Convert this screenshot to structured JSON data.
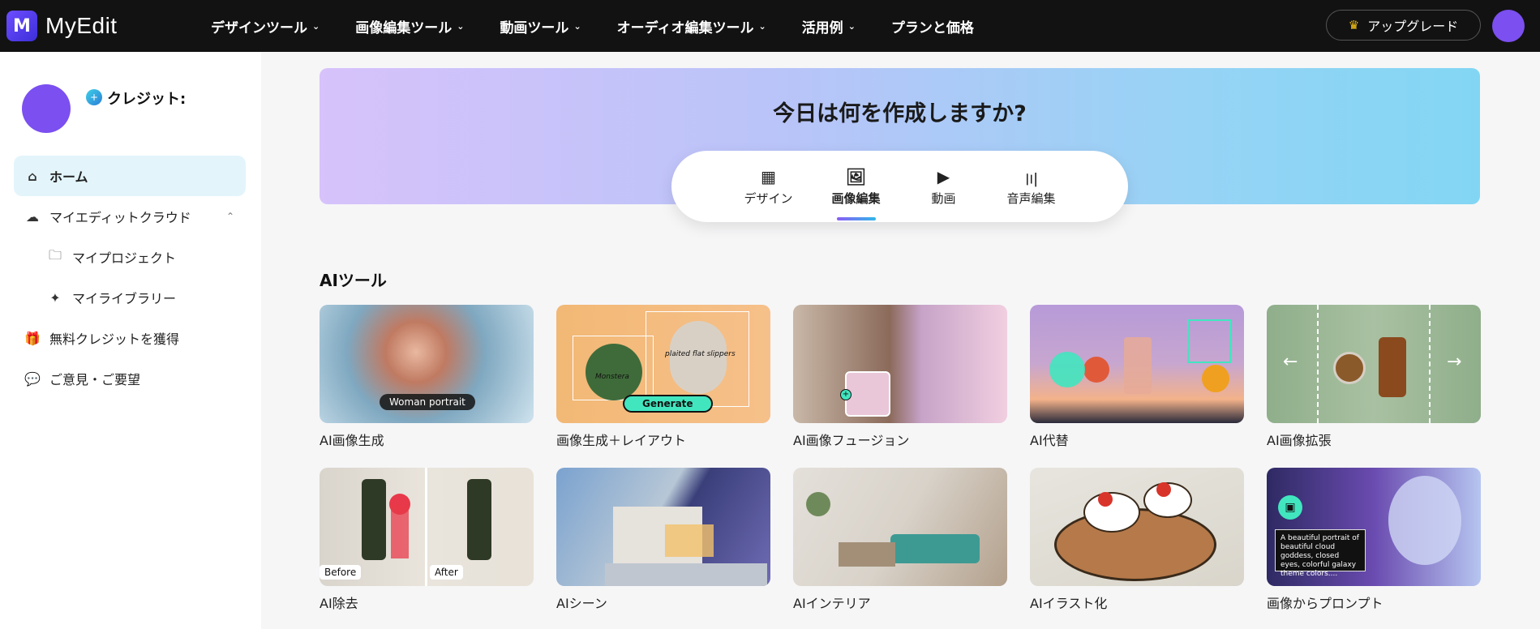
{
  "header": {
    "logo_mark": "M",
    "logo_text": "MyEdit",
    "nav": [
      {
        "label": "デザインツール",
        "has_dropdown": true
      },
      {
        "label": "画像編集ツール",
        "has_dropdown": true
      },
      {
        "label": "動画ツール",
        "has_dropdown": true
      },
      {
        "label": "オーディオ編集ツール",
        "has_dropdown": true
      },
      {
        "label": "活用例",
        "has_dropdown": true
      },
      {
        "label": "プランと価格",
        "has_dropdown": false
      }
    ],
    "upgrade_label": "アップグレード",
    "chevron": "⌄"
  },
  "sidebar": {
    "credit_label": "クレジット:",
    "items": [
      {
        "label": "ホーム",
        "icon": "home-icon",
        "glyph": "⌂",
        "active": true
      },
      {
        "label": "マイエディットクラウド",
        "icon": "cloud-icon",
        "glyph": "☁",
        "caret": "⌃"
      },
      {
        "label": "マイプロジェクト",
        "icon": "folder-icon",
        "glyph": "🗀",
        "sub": true
      },
      {
        "label": "マイライブラリー",
        "icon": "sparkle-icon",
        "glyph": "✦",
        "sub": true
      },
      {
        "label": "無料クレジットを獲得",
        "icon": "gift-icon",
        "glyph": "🎁"
      },
      {
        "label": "ご意見・ご要望",
        "icon": "chat-icon",
        "glyph": "💬"
      }
    ]
  },
  "hero": {
    "title": "今日は何を作成しますか?",
    "tabs": [
      {
        "label": "デザイン",
        "icon": "layout-icon",
        "glyph": "▦",
        "active": false
      },
      {
        "label": "画像編集",
        "icon": "image-icon",
        "glyph": "🖼",
        "active": true
      },
      {
        "label": "動画",
        "icon": "play-icon",
        "glyph": "▶",
        "active": false
      },
      {
        "label": "音声編集",
        "icon": "waveform-icon",
        "glyph": "〣",
        "active": false
      }
    ]
  },
  "ai_tools": {
    "title": "AIツール",
    "cards": [
      {
        "label": "AI画像生成",
        "overlay": "Woman portrait"
      },
      {
        "label": "画像生成＋レイアウト",
        "overlay": "Generate",
        "overlay2": "plaited flat slippers",
        "overlay3": "Monstera"
      },
      {
        "label": "AI画像フュージョン"
      },
      {
        "label": "AI代替"
      },
      {
        "label": "AI画像拡張"
      },
      {
        "label": "AI除去",
        "before": "Before",
        "after": "After"
      },
      {
        "label": "AIシーン"
      },
      {
        "label": "AIインテリア"
      },
      {
        "label": "AIイラスト化"
      },
      {
        "label": "画像からプロンプト",
        "prompt": "A beautiful portrait of beautiful cloud goddess, closed eyes, colorful galaxy theme colors...."
      }
    ]
  },
  "colors": {
    "topbar_bg": "#121212",
    "accent_purple": "#7b4ff0",
    "active_item_bg": "#e3f5fb",
    "generate_green": "#41e6bf"
  }
}
